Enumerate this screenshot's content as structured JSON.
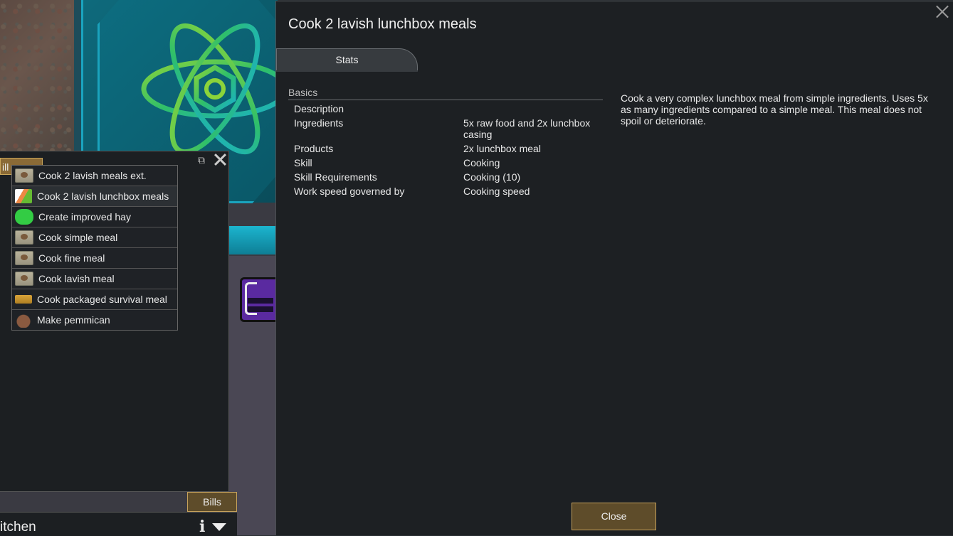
{
  "colors": {
    "panel_bg": "#1d2023",
    "button_bg": "#5e4c2a",
    "button_border": "#c6a25c",
    "accent_cyan": "#1aa4bf"
  },
  "world": {
    "tile_icon": "atom-floor-icon",
    "furniture_icon": "purple-stove-icon"
  },
  "bill_panel": {
    "tab_stub_label": "ill",
    "copy_icon": "copy-icon",
    "close_icon": "close-icon",
    "recipes": [
      {
        "label": "Cook 2 lavish meals ext.",
        "icon": "meal-icon"
      },
      {
        "label": "Cook 2 lavish lunchbox meals",
        "icon": "lunchbox-icon"
      },
      {
        "label": "Create improved hay",
        "icon": "hay-icon"
      },
      {
        "label": "Cook simple meal",
        "icon": "meal-icon"
      },
      {
        "label": "Cook fine meal",
        "icon": "meal-icon"
      },
      {
        "label": "Cook lavish meal",
        "icon": "meal-icon"
      },
      {
        "label": "Cook packaged survival meal",
        "icon": "survival-meal-icon"
      },
      {
        "label": "Make pemmican",
        "icon": "pemmican-icon"
      }
    ],
    "bills_label": "Bills",
    "room_label": "itchen",
    "info_icon_glyph": "i"
  },
  "dialog": {
    "title": "Cook 2 lavish lunchbox meals",
    "tab_label": "Stats",
    "section": "Basics",
    "rows": [
      {
        "key": "Description",
        "value": ""
      },
      {
        "key": "Ingredients",
        "value": "5x raw food and 2x lunchbox casing"
      },
      {
        "key": "Products",
        "value": "2x lunchbox meal"
      },
      {
        "key": "Skill",
        "value": "Cooking"
      },
      {
        "key": "Skill Requirements",
        "value": "Cooking (10)"
      },
      {
        "key": "Work speed governed by",
        "value": "Cooking speed"
      }
    ],
    "description": "Cook a very complex lunchbox meal from simple ingredients. Uses 5x as many ingredients compared to a simple meal. This meal does not spoil or deteriorate.",
    "close_label": "Close"
  }
}
